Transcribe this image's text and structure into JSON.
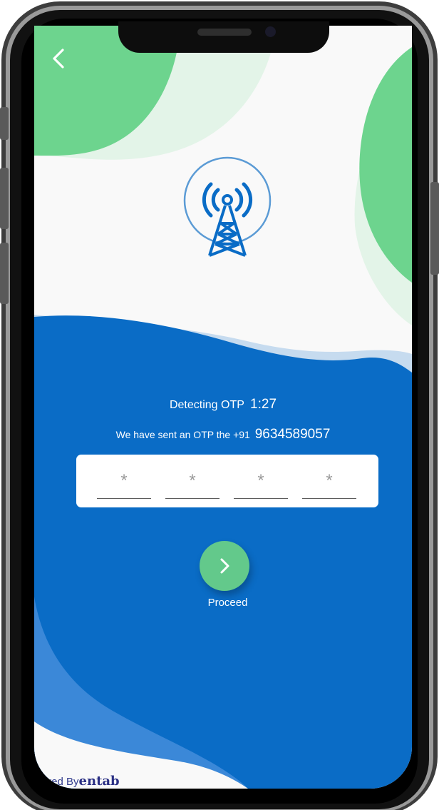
{
  "icons": {
    "back": "chevron-left-icon",
    "tower": "signal-tower-icon",
    "proceed": "chevron-right-icon"
  },
  "otp": {
    "detecting_label": "Detecting OTP",
    "timer": "1:27",
    "sent_label": "We have sent an OTP the +91",
    "phone_number": "9634589057",
    "digits": [
      "*",
      "*",
      "*",
      "*"
    ]
  },
  "proceed": {
    "label": "Proceed"
  },
  "footer": {
    "powered_by": "wered By",
    "brand": "entab"
  },
  "colors": {
    "primary_blue": "#0a6cc6",
    "accent_green": "#6dd48e",
    "light_green": "#e3f4e8",
    "light_blue": "#c6dbef",
    "background": "#f9f9f9"
  }
}
